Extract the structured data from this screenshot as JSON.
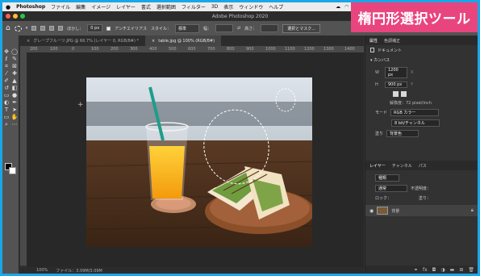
{
  "menubar": {
    "app": "Photoshop",
    "items": [
      "ファイル",
      "編集",
      "イメージ",
      "レイヤー",
      "書式",
      "選択範囲",
      "フィルター",
      "3D",
      "表示",
      "ウィンドウ",
      "ヘルプ"
    ]
  },
  "window_title": "Adobe Photoshop 2020",
  "banner": "楕円形選択ツール",
  "options": {
    "feather_label": "ぼかし：",
    "feather_value": "0 px",
    "antialias_label": "アンチエイリアス",
    "style_label": "スタイル：",
    "style_value": "標準",
    "width_label": "幅：",
    "height_label": "高さ：",
    "select_mask_button": "選択とマスク..."
  },
  "tabs": [
    {
      "label": "グレープフルーツ.JPG @ 66.7% (レイヤー 0, RGB/8#) *",
      "active": false
    },
    {
      "label": "table.jpg @ 100% (RGB/8#)",
      "active": true
    }
  ],
  "ruler": [
    "200",
    "100",
    "0",
    "100",
    "200",
    "300",
    "400",
    "500",
    "600",
    "700",
    "800",
    "900",
    "1000",
    "1100",
    "1200",
    "1300",
    "1400"
  ],
  "status": {
    "zoom": "100%",
    "file": "ファイル：3.09M/3.09M"
  },
  "properties": {
    "tabs": [
      "属性",
      "色調補正"
    ],
    "doc_label": "ドキュメント",
    "canvas_section": "カンバス",
    "width_label": "W",
    "width_value": "1200 px",
    "height_label": "H",
    "height_value": "900 px",
    "x_label": "X",
    "y_label": "Y",
    "resolution": "解像度：72 pixel/inch",
    "mode_label": "モード",
    "mode_value": "RGB カラー",
    "depth_value": "8 bit/チャンネル",
    "fill_label": "塗り",
    "fill_value": "背景色"
  },
  "layers": {
    "tabs": [
      "レイヤー",
      "チャンネル",
      "パス"
    ],
    "kind_label": "種類",
    "mode_label": "通常",
    "opacity_label": "不透明度：",
    "lock_label": "ロック：",
    "fill_label": "塗り：",
    "layer_name": "背景"
  }
}
